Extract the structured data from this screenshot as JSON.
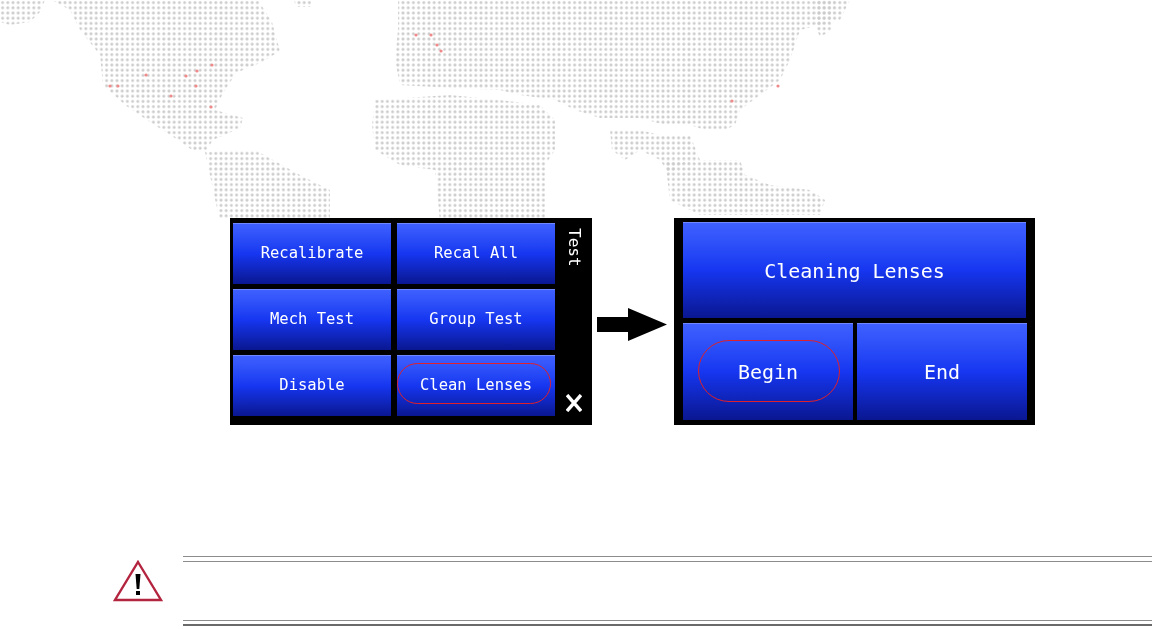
{
  "left_panel": {
    "title": "Test",
    "buttons": [
      {
        "label": "Recalibrate",
        "highlighted": false
      },
      {
        "label": "Recal All",
        "highlighted": false
      },
      {
        "label": "Mech Test",
        "highlighted": false
      },
      {
        "label": "Group Test",
        "highlighted": false
      },
      {
        "label": "Disable",
        "highlighted": false
      },
      {
        "label": "Clean Lenses",
        "highlighted": true
      }
    ]
  },
  "right_panel": {
    "banner": {
      "label": "Cleaning Lenses"
    },
    "buttons": [
      {
        "label": "Begin",
        "highlighted": true
      },
      {
        "label": "End",
        "highlighted": false
      }
    ]
  }
}
